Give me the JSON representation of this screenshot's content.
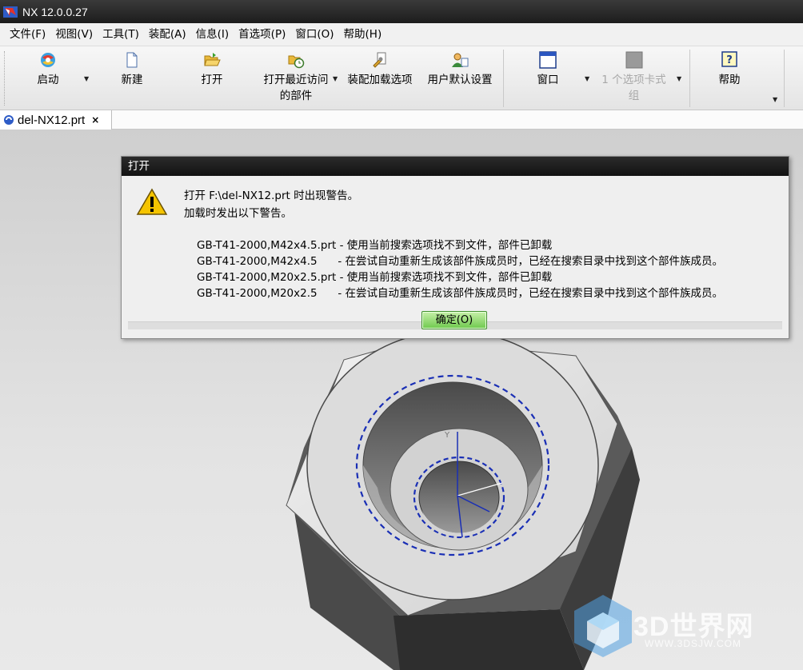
{
  "window": {
    "title": "NX 12.0.0.27"
  },
  "menu": [
    {
      "label": "文件(F)"
    },
    {
      "label": "视图(V)"
    },
    {
      "label": "工具(T)"
    },
    {
      "label": "装配(A)"
    },
    {
      "label": "信息(I)"
    },
    {
      "label": "首选项(P)"
    },
    {
      "label": "窗口(O)"
    },
    {
      "label": "帮助(H)"
    }
  ],
  "ribbon": {
    "start": "启动",
    "new": "新建",
    "open": "打开",
    "recent_line1": "打开最近访问",
    "recent_line2": "的部件",
    "assembly_load": "装配加载选项",
    "user_defaults": "用户默认设置",
    "window": "窗口",
    "tab_group_line1": "1 个选项卡式",
    "tab_group_line2": "组",
    "help": "帮助"
  },
  "tab": {
    "label": "del-NX12.prt",
    "close": "×"
  },
  "dialog": {
    "title": "打开",
    "line1": "打开 F:\\del-NX12.prt 时出现警告。",
    "line2": "加载时发出以下警告。",
    "details": [
      "GB-T41-2000,M42x4.5.prt - 使用当前搜索选项找不到文件，部件已卸载",
      "GB-T41-2000,M42x4.5      - 在尝试自动重新生成该部件族成员时，已经在搜索目录中找到这个部件族成员。",
      "GB-T41-2000,M20x2.5.prt - 使用当前搜索选项找不到文件，部件已卸载",
      "GB-T41-2000,M20x2.5      - 在尝试自动重新生成该部件族成员时，已经在搜索目录中找到这个部件族成员。"
    ],
    "ok": "确定(O)"
  },
  "viewport": {
    "axis_label": "Y"
  },
  "watermark": {
    "logo": "3D世界网",
    "url": "WWW.3DSJW.COM"
  },
  "colors": {
    "titlebar": "#1c1c1c",
    "ok_button": "#6ec94d",
    "dashed_circle": "#1a2fb5"
  }
}
